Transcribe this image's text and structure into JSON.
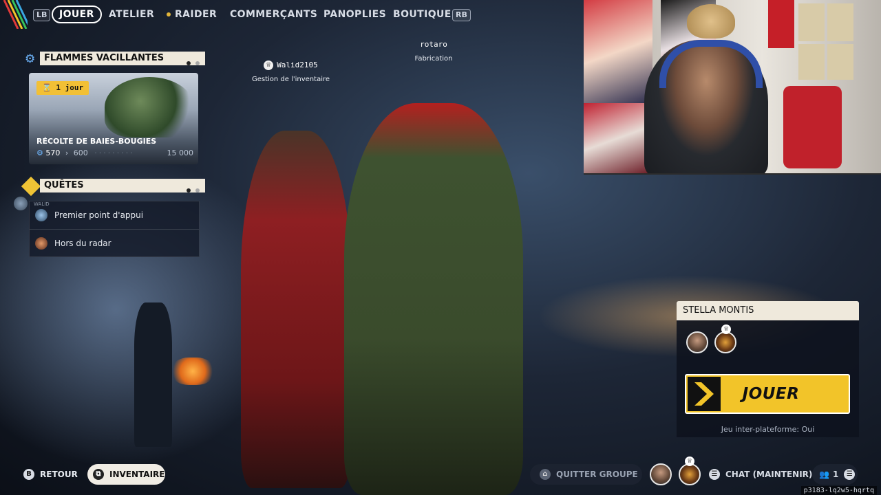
{
  "nav": {
    "lb": "LB",
    "rb": "RB",
    "tabs": [
      {
        "label": "JOUER"
      },
      {
        "label": "ATELIER"
      },
      {
        "label": "RAIDER"
      },
      {
        "label": "COMMERÇANTS"
      },
      {
        "label": "PANOPLIES"
      },
      {
        "label": "BOUTIQUE"
      }
    ]
  },
  "event": {
    "title": "FLAMMES VACILLANTES",
    "time_badge": "1 jour",
    "card_title": "RÉCOLTE DE BAIES-BOUGIES",
    "progress_current": "570",
    "progress_next": "600",
    "progress_max": "15 000"
  },
  "quests": {
    "title": "QUÊTES",
    "owner_tag": "WALID",
    "items": [
      {
        "label": "Premier point d'appui"
      },
      {
        "label": "Hors du radar"
      }
    ]
  },
  "players": [
    {
      "name": "Walid2105",
      "activity": "Gestion de l'inventaire"
    },
    {
      "name": "rotaro",
      "activity": "Fabrication"
    }
  ],
  "mode": {
    "name": "STELLA MONTIS",
    "play_label": "JOUER",
    "crossplay": "Jeu inter-plateforme: Oui"
  },
  "bottom": {
    "back_key": "B",
    "back_label": "RETOUR",
    "inventory_label": "INVENTAIRE",
    "leave_group": "QUITTER GROUPE",
    "chat": "CHAT (MAINTENIR)",
    "party_count": "1",
    "code": "p3183-lq2w5-hqrtq"
  },
  "colors": {
    "accent_yellow": "#f2c429",
    "panel_cream": "#efe9dc",
    "dot_dark": "#222222",
    "dot_light": "#a8a8a8"
  }
}
